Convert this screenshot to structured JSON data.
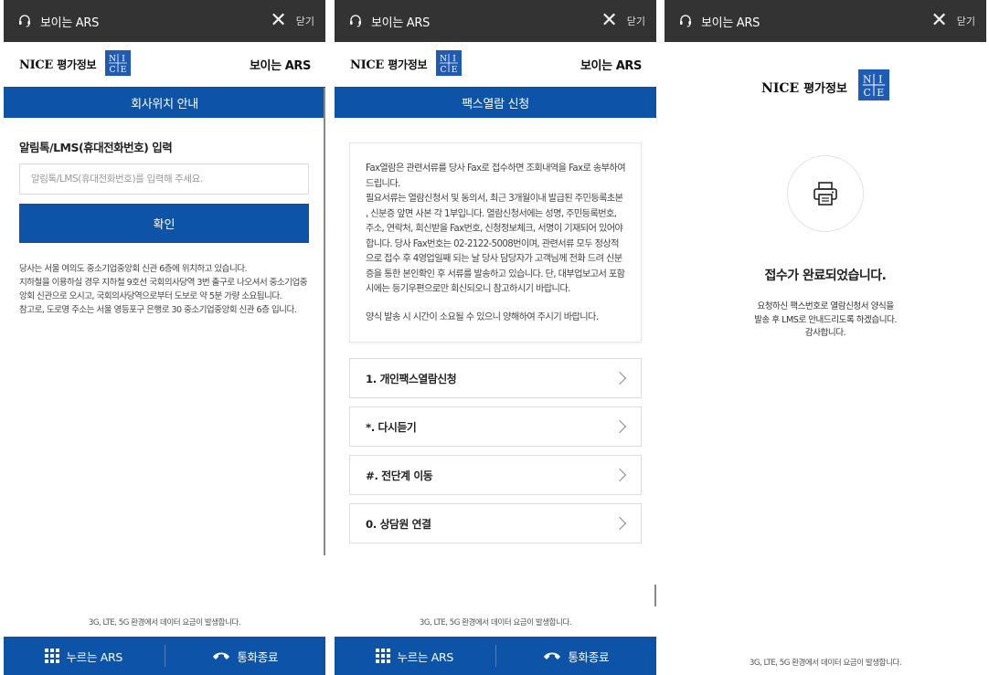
{
  "common": {
    "window_title": "보이는 ARS",
    "close_label": "닫기",
    "brand_name": "NICE",
    "brand_name_kr": "평가정보",
    "logo_letters": [
      "N",
      "I",
      "C",
      "E"
    ],
    "service_name": "보이는 ARS",
    "data_notice": "3G, LTE, 5G 환경에서 데이터 요금이 발생합니다.",
    "bottom_left_label": "누르는 ARS",
    "bottom_right_label": "통화종료"
  },
  "panel1": {
    "header": "회사위치 안내",
    "input_label": "알림톡/LMS(휴대전화번호) 입력",
    "input_placeholder": "알림톡/LMS(휴대전화번호)를 입력해 주세요.",
    "input_value": "",
    "confirm_label": "확인",
    "description": [
      "당사는 서울 여의도 중소기업중앙회 신관 6층에 위치하고 있습니다.",
      "지하철을 이용하실 경우 지하철 9호선 국회의사당역 3번 출구로 나오셔서 중소기업중앙회 신관으로 오시고, 국회의사당역으로부터 도보로 약 5분 가량 소요됩니다.",
      "참고로, 도로명 주소는 서울 영등포구 은행로 30 중소기업중앙회 신관 6층 입니다."
    ]
  },
  "panel2": {
    "header": "팩스열람 신청",
    "info_paragraph1": "Fax열람은 관련서류를 당사 Fax로 접수하면 조회내역을 Fax로 송부하여 드립니다.",
    "info_paragraph2": "필요서류는 열람신청서 및 동의서, 최근 3개월이내 발급된 주민등록초본 , 신분증 앞면 사본 각 1부입니다. 열람신청서에는 성명, 주민등록번호, 주소, 연락처, 회신받을 Fax번호, 신청정보체크, 서명이 기재되어 있어야 합니다. 당사 Fax번호는 02-2122-5008번이며, 관련서류 모두 정상적으로 접수 후 4영업일째 되는 날 당사 담당자가 고객님께 전화 드려 신분증을 통한 본인확인 후 서류를 발송하고 있습니다. 단, 대부업보고서 포함 시에는 등기우편으로만 회신되오니 참고하시기 바랍니다.",
    "info_paragraph3": "양식 발송 시 시간이 소요될 수 있으니 양해하여 주시기 바랍니다.",
    "menu_items": [
      {
        "label": "1. 개인팩스열람신청"
      },
      {
        "label": "*. 다시듣기"
      },
      {
        "label": "#. 전단계 이동"
      },
      {
        "label": "0. 상담원 연결"
      }
    ]
  },
  "panel3": {
    "done_title": "접수가 완료되었습니다.",
    "done_message": [
      "요청하신 팩스번호로 열람신청서 양식을",
      "발송 후 LMS로 안내드리도록 하겠습니다.",
      "감사합니다."
    ]
  },
  "colors": {
    "titlebar": "#333333",
    "primary_blue": "#0d53a8",
    "logo_blue": "#1e5bb5"
  }
}
